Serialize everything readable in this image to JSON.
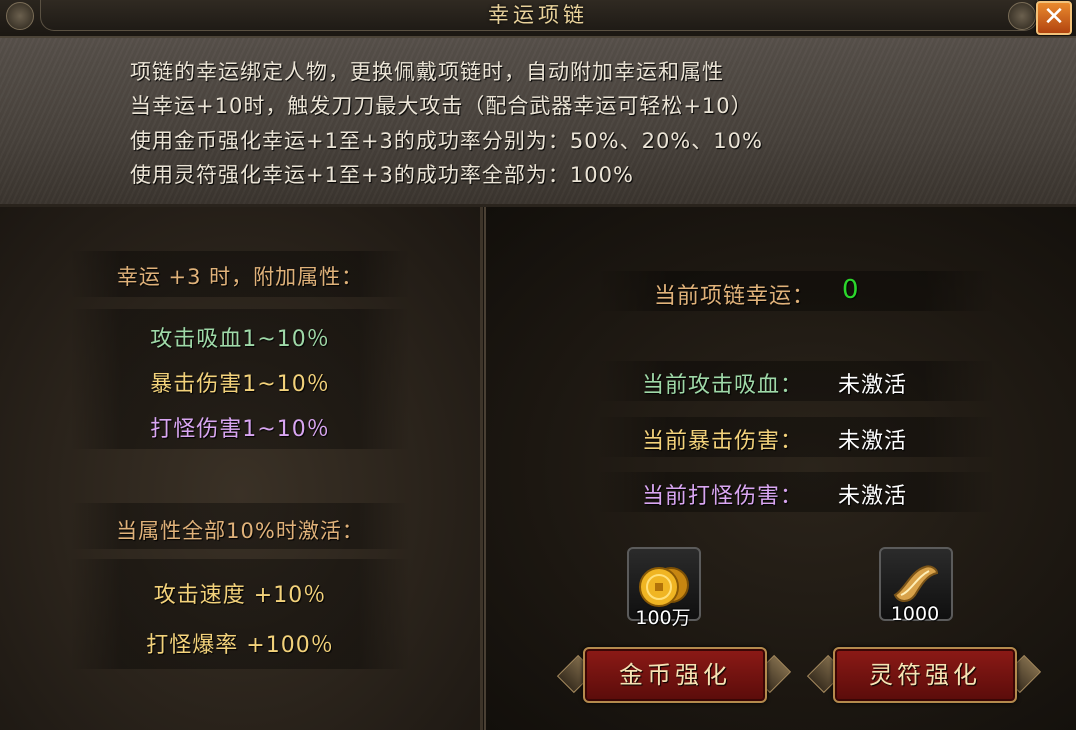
{
  "window": {
    "title": "幸运项链",
    "close_label": "✕"
  },
  "info_lines": [
    "项链的幸运绑定人物，更换佩戴项链时，自动附加幸运和属性",
    "当幸运+10时，触发刀刀最大攻击（配合武器幸运可轻松+10）",
    "使用金币强化幸运+1至+3的成功率分别为：50%、20%、10%",
    "使用灵符强化幸运+1至+3的成功率全部为：100%"
  ],
  "left": {
    "header1": "幸运 +3 时，附加属性：",
    "attrs1": [
      {
        "label": "攻击吸血1~10％",
        "color": "#9fd9a8"
      },
      {
        "label": "暴击伤害1~10％",
        "color": "#f3d27b"
      },
      {
        "label": "打怪伤害1~10％",
        "color": "#d9a6f2"
      }
    ],
    "header2": "当属性全部10%时激活：",
    "attrs2": [
      {
        "label": "攻击速度 +10％",
        "color": "#f3d27b"
      },
      {
        "label": "打怪爆率 +100％",
        "color": "#f3d27b"
      }
    ]
  },
  "right": {
    "luck_label": "当前项链幸运：",
    "luck_value": "0",
    "stats": [
      {
        "label": "当前攻击吸血：",
        "value": "未激活",
        "color": "#9fd9a8"
      },
      {
        "label": "当前暴击伤害：",
        "value": "未激活",
        "color": "#f3d27b"
      },
      {
        "label": "当前打怪伤害：",
        "value": "未激活",
        "color": "#d9a6f2"
      }
    ],
    "items": [
      {
        "name": "gold-coin",
        "icon": "coins-icon",
        "count": "100万",
        "button": "金币强化"
      },
      {
        "name": "talisman",
        "icon": "scroll-icon",
        "count": "1000",
        "button": "灵符强化"
      }
    ]
  },
  "colors": {
    "title": "#e9d29b",
    "luck_value": "#2bd62b",
    "header": "#e0b27a",
    "button_bg": "#8c1a16"
  }
}
